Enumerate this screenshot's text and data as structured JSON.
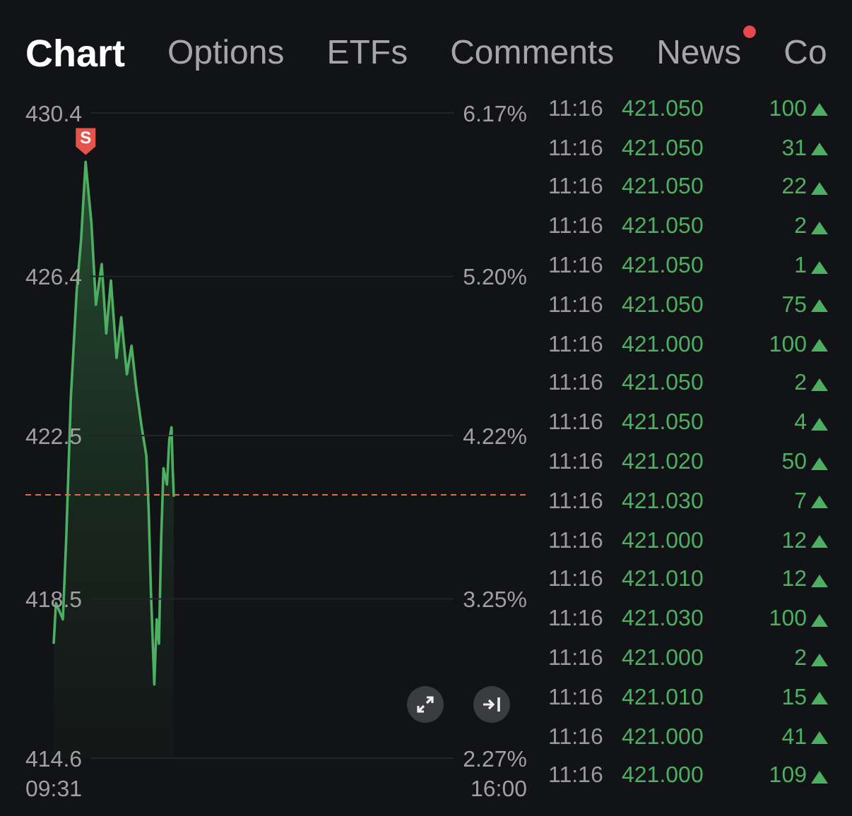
{
  "tabs": [
    {
      "label": "Chart",
      "selected": true,
      "badge": false
    },
    {
      "label": "Options",
      "selected": false,
      "badge": false
    },
    {
      "label": "ETFs",
      "selected": false,
      "badge": false
    },
    {
      "label": "Comments",
      "selected": false,
      "badge": false
    },
    {
      "label": "News",
      "selected": false,
      "badge": true
    },
    {
      "label": "Co",
      "selected": false,
      "badge": false
    }
  ],
  "chart": {
    "chart_data": {
      "type": "line",
      "xlim": [
        9.517,
        16.0
      ],
      "ylim": [
        414.6,
        430.4
      ],
      "xticks": [
        {
          "value": 9.517,
          "label": "09:31"
        },
        {
          "value": 16.0,
          "label": "16:00"
        }
      ],
      "yticks": [
        {
          "value": 430.4,
          "label": "430.4"
        },
        {
          "value": 426.4,
          "label": "426.4"
        },
        {
          "value": 422.5,
          "label": "422.5"
        },
        {
          "value": 418.5,
          "label": "418.5"
        },
        {
          "value": 414.6,
          "label": "414.6"
        }
      ],
      "x": [
        9.517,
        9.55,
        9.65,
        9.7,
        9.767,
        9.85,
        9.917,
        9.983,
        10.067,
        10.133,
        10.217,
        10.283,
        10.35,
        10.433,
        10.5,
        10.583,
        10.65,
        10.717,
        10.8,
        10.867,
        10.9,
        10.933,
        10.983,
        11.017,
        11.05,
        11.083,
        11.117,
        11.167,
        11.2,
        11.233,
        11.25,
        11.267
      ],
      "grid": true,
      "ref_lines": [
        {
          "axis": "y",
          "value": 421.05
        }
      ],
      "series": [
        {
          "color": "#4caf61",
          "values": [
            417.4,
            418.4,
            418.0,
            420.0,
            423.4,
            426.0,
            427.3,
            429.2,
            427.7,
            425.7,
            426.7,
            425.0,
            426.3,
            424.4,
            425.4,
            424.0,
            424.7,
            423.7,
            422.7,
            422.0,
            420.7,
            418.7,
            416.4,
            418.0,
            417.4,
            420.0,
            421.7,
            421.3,
            422.4,
            422.7,
            421.7,
            421.0
          ]
        }
      ]
    },
    "signal_marker": {
      "label": "S"
    },
    "percent_labels": [
      "6.17%",
      "5.20%",
      "4.22%",
      "3.25%",
      "2.27%"
    ]
  },
  "trades": [
    {
      "time": "11:16",
      "price": "421.050",
      "volume": "100",
      "rising": true
    },
    {
      "time": "11:16",
      "price": "421.050",
      "volume": "31",
      "rising": true
    },
    {
      "time": "11:16",
      "price": "421.050",
      "volume": "22",
      "rising": true
    },
    {
      "time": "11:16",
      "price": "421.050",
      "volume": "2",
      "rising": true
    },
    {
      "time": "11:16",
      "price": "421.050",
      "volume": "1",
      "rising": true
    },
    {
      "time": "11:16",
      "price": "421.050",
      "volume": "75",
      "rising": true
    },
    {
      "time": "11:16",
      "price": "421.000",
      "volume": "100",
      "rising": true
    },
    {
      "time": "11:16",
      "price": "421.050",
      "volume": "2",
      "rising": true
    },
    {
      "time": "11:16",
      "price": "421.050",
      "volume": "4",
      "rising": true
    },
    {
      "time": "11:16",
      "price": "421.020",
      "volume": "50",
      "rising": true
    },
    {
      "time": "11:16",
      "price": "421.030",
      "volume": "7",
      "rising": true
    },
    {
      "time": "11:16",
      "price": "421.000",
      "volume": "12",
      "rising": true
    },
    {
      "time": "11:16",
      "price": "421.010",
      "volume": "12",
      "rising": true
    },
    {
      "time": "11:16",
      "price": "421.030",
      "volume": "100",
      "rising": true
    },
    {
      "time": "11:16",
      "price": "421.000",
      "volume": "2",
      "rising": true
    },
    {
      "time": "11:16",
      "price": "421.010",
      "volume": "15",
      "rising": true
    },
    {
      "time": "11:16",
      "price": "421.000",
      "volume": "41",
      "rising": true
    },
    {
      "time": "11:16",
      "price": "421.000",
      "volume": "109",
      "rising": true
    }
  ]
}
